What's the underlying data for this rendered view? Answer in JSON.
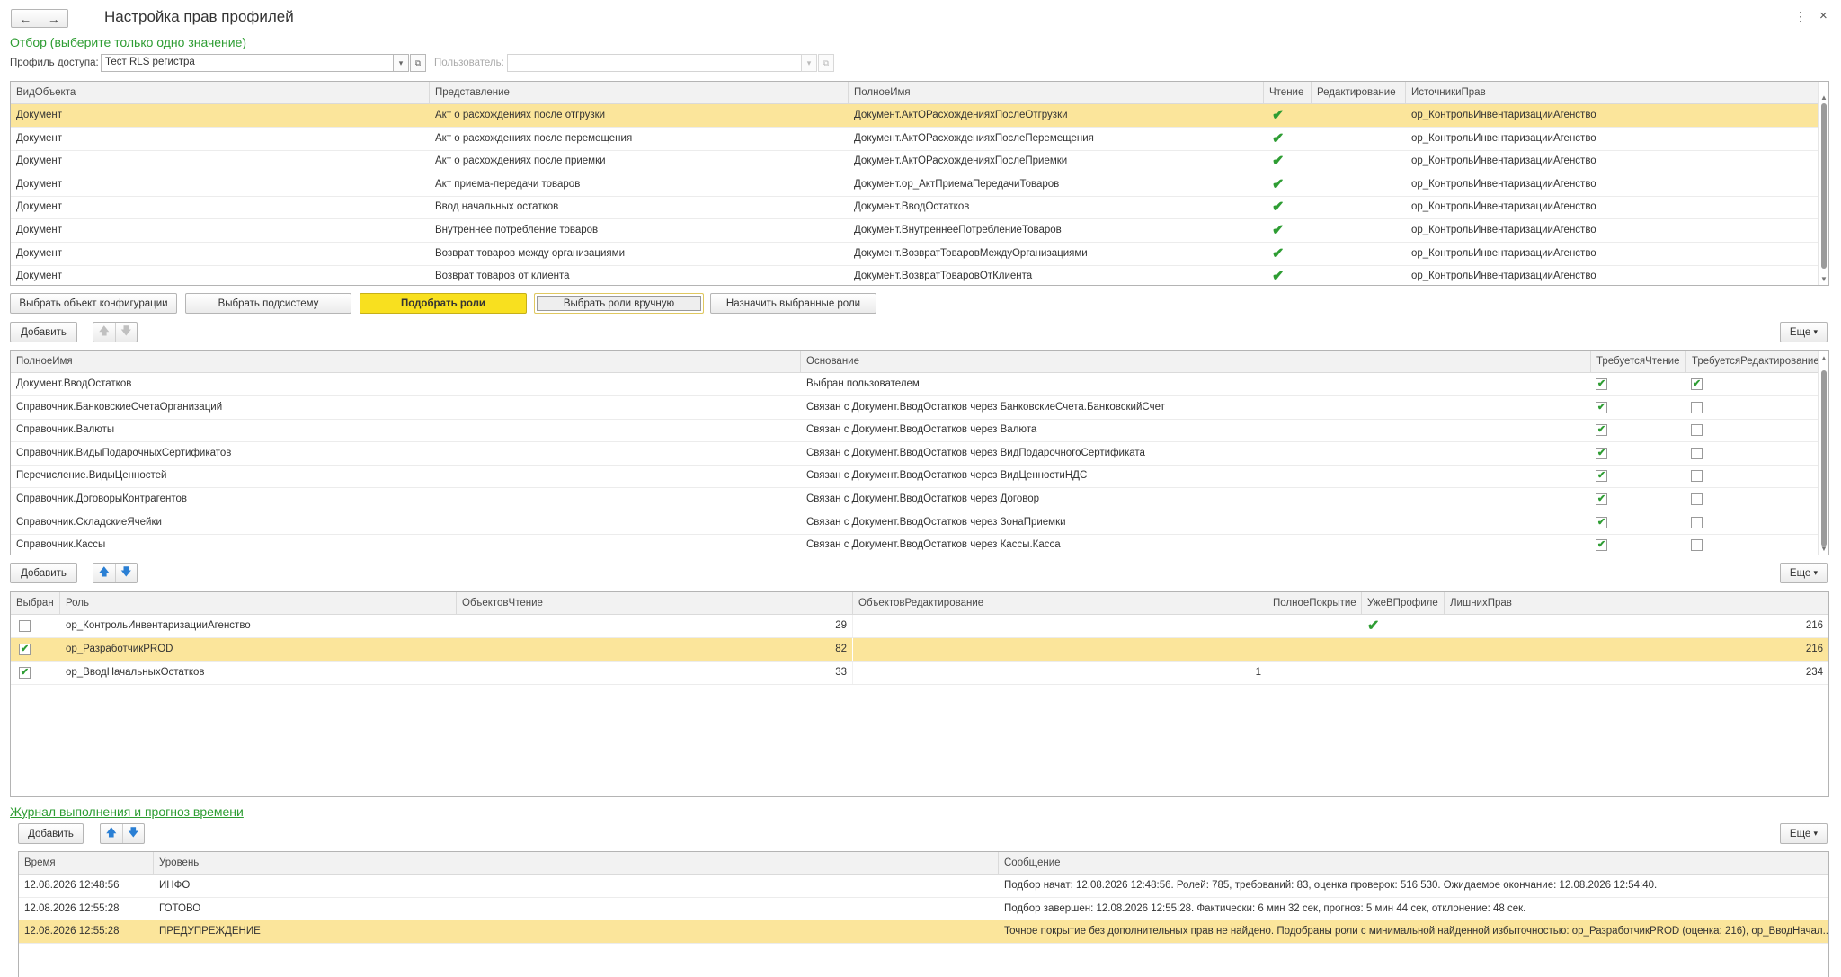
{
  "window": {
    "title": "Настройка прав профилей",
    "back_icon": "←",
    "forward_icon": "→",
    "menu_icon": "⋮",
    "close_icon": "×"
  },
  "filter": {
    "caption": "Отбор (выберите только одно значение)",
    "profile_label": "Профиль доступа:",
    "profile_value": "Тест RLS регистра",
    "user_label": "Пользователь:",
    "user_value": ""
  },
  "objects_table": {
    "columns": [
      "ВидОбъекта",
      "Представление",
      "ПолноеИмя",
      "Чтение",
      "Редактирование",
      "ИсточникиПрав"
    ],
    "rows": [
      {
        "kind": "Документ",
        "presentation": "Акт о расхождениях после отгрузки",
        "full_name": "Документ.АктОРасхожденияхПослеОтгрузки",
        "read": true,
        "edit": false,
        "sources": "ор_КонтрольИнвентаризацииАгенство",
        "selected": true
      },
      {
        "kind": "Документ",
        "presentation": "Акт о расхождениях после перемещения",
        "full_name": "Документ.АктОРасхожденияхПослеПеремещения",
        "read": true,
        "edit": false,
        "sources": "ор_КонтрольИнвентаризацииАгенство",
        "selected": false
      },
      {
        "kind": "Документ",
        "presentation": "Акт о расхождениях после приемки",
        "full_name": "Документ.АктОРасхожденияхПослеПриемки",
        "read": true,
        "edit": false,
        "sources": "ор_КонтрольИнвентаризацииАгенство",
        "selected": false
      },
      {
        "kind": "Документ",
        "presentation": "Акт приема-передачи товаров",
        "full_name": "Документ.ор_АктПриемаПередачиТоваров",
        "read": true,
        "edit": false,
        "sources": "ор_КонтрольИнвентаризацииАгенство",
        "selected": false
      },
      {
        "kind": "Документ",
        "presentation": "Ввод начальных остатков",
        "full_name": "Документ.ВводОстатков",
        "read": true,
        "edit": false,
        "sources": "ор_КонтрольИнвентаризацииАгенство",
        "selected": false
      },
      {
        "kind": "Документ",
        "presentation": "Внутреннее потребление товаров",
        "full_name": "Документ.ВнутреннееПотреблениеТоваров",
        "read": true,
        "edit": false,
        "sources": "ор_КонтрольИнвентаризацииАгенство",
        "selected": false
      },
      {
        "kind": "Документ",
        "presentation": "Возврат товаров между организациями",
        "full_name": "Документ.ВозвратТоваровМеждуОрганизациями",
        "read": true,
        "edit": false,
        "sources": "ор_КонтрольИнвентаризацииАгенство",
        "selected": false
      },
      {
        "kind": "Документ",
        "presentation": "Возврат товаров от клиента",
        "full_name": "Документ.ВозвратТоваровОтКлиента",
        "read": true,
        "edit": false,
        "sources": "ор_КонтрольИнвентаризацииАгенство",
        "selected": false
      }
    ]
  },
  "action_buttons": {
    "select_config_object": "Выбрать объект конфигурации",
    "select_subsystem": "Выбрать подсистему",
    "pick_roles": "Подобрать роли",
    "select_roles_manually": "Выбрать роли вручную",
    "assign_selected_roles": "Назначить выбранные роли"
  },
  "toolbar": {
    "add_label": "Добавить",
    "more_label": "Еще",
    "up_icon": "🡅",
    "down_icon": "🡇",
    "dropdown_icon": "▾"
  },
  "requirements_table": {
    "columns": [
      "ПолноеИмя",
      "Основание",
      "ТребуетсяЧтение",
      "ТребуетсяРедактирование"
    ],
    "rows": [
      {
        "full_name": "Документ.ВводОстатков",
        "reason": "Выбран пользователем",
        "need_read": true,
        "need_edit": true
      },
      {
        "full_name": "Справочник.БанковскиеСчетаОрганизаций",
        "reason": "Связан с Документ.ВводОстатков через БанковскиеСчета.БанковскийСчет",
        "need_read": true,
        "need_edit": false
      },
      {
        "full_name": "Справочник.Валюты",
        "reason": "Связан с Документ.ВводОстатков через Валюта",
        "need_read": true,
        "need_edit": false
      },
      {
        "full_name": "Справочник.ВидыПодарочныхСертификатов",
        "reason": "Связан с Документ.ВводОстатков через ВидПодарочногоСертификата",
        "need_read": true,
        "need_edit": false
      },
      {
        "full_name": "Перечисление.ВидыЦенностей",
        "reason": "Связан с Документ.ВводОстатков через ВидЦенностиНДС",
        "need_read": true,
        "need_edit": false
      },
      {
        "full_name": "Справочник.ДоговорыКонтрагентов",
        "reason": "Связан с Документ.ВводОстатков через Договор",
        "need_read": true,
        "need_edit": false
      },
      {
        "full_name": "Справочник.СкладскиеЯчейки",
        "reason": "Связан с Документ.ВводОстатков через ЗонаПриемки",
        "need_read": true,
        "need_edit": false
      },
      {
        "full_name": "Справочник.Кассы",
        "reason": "Связан с Документ.ВводОстатков через Кассы.Касса",
        "need_read": true,
        "need_edit": false
      }
    ]
  },
  "roles_table": {
    "columns": [
      "Выбран",
      "Роль",
      "ОбъектовЧтение",
      "ОбъектовРедактирование",
      "ПолноеПокрытие",
      "УжеВПрофиле",
      "ЛишнихПрав"
    ],
    "rows": [
      {
        "chosen": false,
        "role": "ор_КонтрольИнвентаризацииАгенство",
        "read_count": "29",
        "edit_count": "",
        "full_cover": false,
        "in_profile": true,
        "extra": "216",
        "selected": false
      },
      {
        "chosen": true,
        "role": "ор_РазработчикPROD",
        "read_count": "82",
        "edit_count": "",
        "full_cover": false,
        "in_profile": false,
        "extra": "216",
        "selected": true
      },
      {
        "chosen": true,
        "role": "ор_ВводНачальныхОстатков",
        "read_count": "33",
        "edit_count": "1",
        "full_cover": false,
        "in_profile": false,
        "extra": "234",
        "selected": false
      }
    ]
  },
  "log": {
    "caption": "Журнал выполнения и прогноз времени",
    "columns": [
      "Время",
      "Уровень",
      "Сообщение"
    ],
    "rows": [
      {
        "time": "12.08.2026 12:48:56",
        "level": "ИНФО",
        "message": "Подбор начат: 12.08.2026 12:48:56. Ролей: 785, требований: 83, оценка проверок: 516 530. Ожидаемое окончание: 12.08.2026 12:54:40.",
        "selected": false
      },
      {
        "time": "12.08.2026 12:55:28",
        "level": "ГОТОВО",
        "message": "Подбор завершен: 12.08.2026 12:55:28. Фактически: 6 мин 32 сек, прогноз: 5 мин 44 сек, отклонение: 48 сек.",
        "selected": false
      },
      {
        "time": "12.08.2026 12:55:28",
        "level": "ПРЕДУПРЕЖДЕНИЕ",
        "message": "Точное покрытие без дополнительных прав не найдено. Подобраны роли с минимальной найденной избыточностью: ор_РазработчикPROD (оценка: 216), ор_ВводНачал...",
        "selected": true
      }
    ]
  },
  "glyphs": {
    "check": "✔",
    "dd": "▾",
    "open": "⧉",
    "scroll_up": "▲",
    "scroll_down": "▼"
  }
}
